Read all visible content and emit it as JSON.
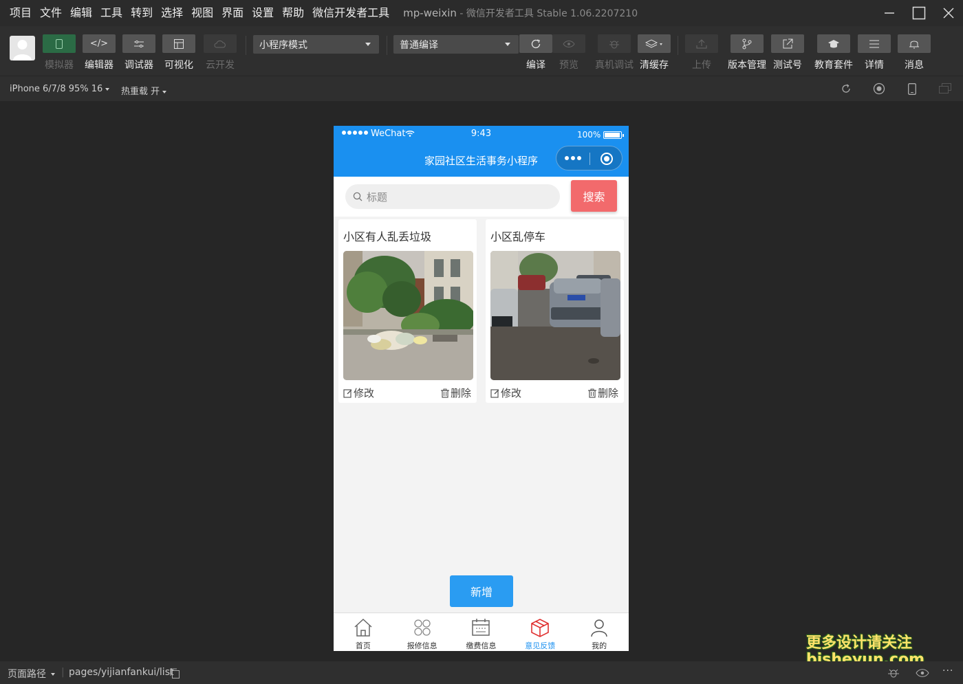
{
  "menu": [
    "项目",
    "文件",
    "编辑",
    "工具",
    "转到",
    "选择",
    "视图",
    "界面",
    "设置",
    "帮助",
    "微信开发者工具"
  ],
  "window": {
    "project": "mp-weixin",
    "separator": " - ",
    "app": "微信开发者工具 Stable 1.06.2207210"
  },
  "toolbar": {
    "left_tools": [
      {
        "label": "模拟器",
        "icon": "phone-icon"
      },
      {
        "label": "编辑器",
        "icon": "code-icon"
      },
      {
        "label": "调试器",
        "icon": "debug-sliders-icon"
      },
      {
        "label": "可视化",
        "icon": "layout-icon"
      },
      {
        "label": "云开发",
        "icon": "cloud-icon"
      }
    ],
    "mode_select": "小程序模式",
    "compile_select": "普通编译",
    "right_tools": [
      {
        "label": "编译",
        "icon": "refresh-icon"
      },
      {
        "label": "预览",
        "icon": "eye-icon"
      },
      {
        "label": "真机调试",
        "icon": "bug-icon"
      },
      {
        "label": "清缓存",
        "icon": "layers-icon"
      },
      {
        "label": "上传",
        "icon": "upload-icon"
      },
      {
        "label": "版本管理",
        "icon": "branch-icon"
      },
      {
        "label": "测试号",
        "icon": "external-link-icon"
      },
      {
        "label": "教育套件",
        "icon": "graduation-cap-icon"
      },
      {
        "label": "详情",
        "icon": "menu-lines-icon"
      },
      {
        "label": "消息",
        "icon": "bell-icon"
      }
    ]
  },
  "subbar": {
    "device": "iPhone 6/7/8 95% 16",
    "hot_reload": "热重载 开"
  },
  "phone": {
    "carrier": "WeChat",
    "time": "9:43",
    "battery": "100%",
    "nav_title": "家园社区生活事务小程序",
    "search": {
      "placeholder": "标题",
      "button": "搜索"
    },
    "cards": [
      {
        "title": "小区有人乱丢垃圾",
        "edit": "修改",
        "delete": "删除"
      },
      {
        "title": "小区乱停车",
        "edit": "修改",
        "delete": "删除"
      }
    ],
    "add_button": "新增",
    "tabs": [
      {
        "label": "首页",
        "icon": "home-icon"
      },
      {
        "label": "报修信息",
        "icon": "grid-icon"
      },
      {
        "label": "缴费信息",
        "icon": "calendar-icon"
      },
      {
        "label": "意见反馈",
        "icon": "box-icon",
        "active": true
      },
      {
        "label": "我的",
        "icon": "user-icon"
      }
    ],
    "accent_color": "#1a90f0",
    "search_button_color": "#f26a6c"
  },
  "bottombar": {
    "path_label": "页面路径",
    "path": "pages/yijianfankui/list"
  },
  "watermark": {
    "line1": "更多设计请关注",
    "line2": "bisheyun.com"
  }
}
